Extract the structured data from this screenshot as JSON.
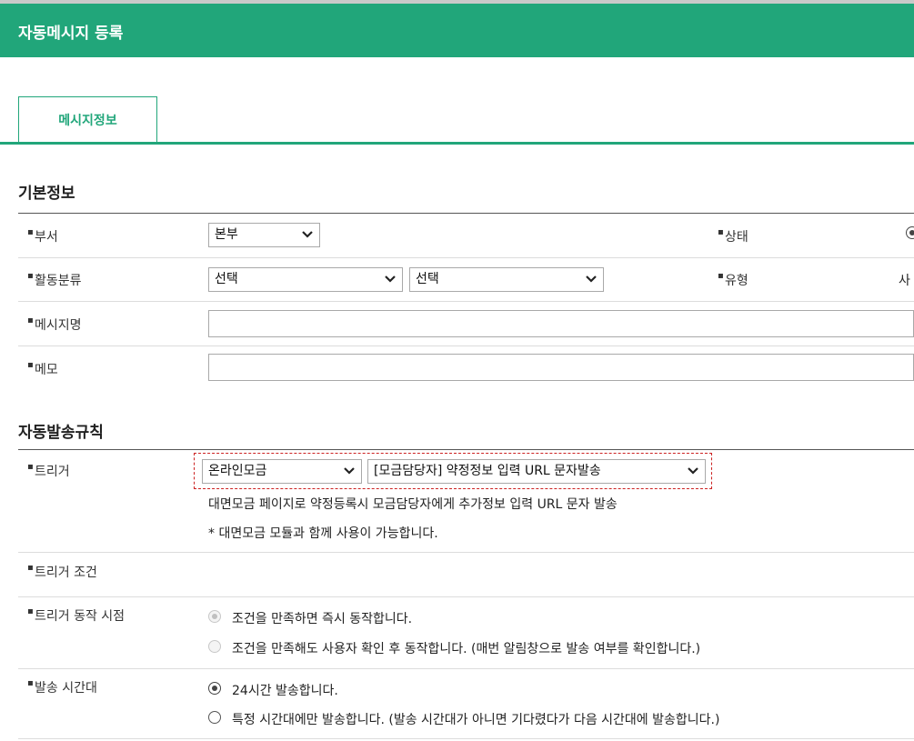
{
  "header": {
    "title": "자동메시지 등록"
  },
  "tabs": [
    {
      "label": "메시지정보"
    }
  ],
  "basic": {
    "title": "기본정보",
    "department": {
      "label": "부서",
      "value": "본부"
    },
    "status": {
      "label": "상태"
    },
    "activity": {
      "label": "활동분류",
      "value1": "선택",
      "value2": "선택"
    },
    "type": {
      "label": "유형",
      "value": "사"
    },
    "message_name": {
      "label": "메시지명",
      "value": ""
    },
    "memo": {
      "label": "메모",
      "value": ""
    }
  },
  "rules": {
    "title": "자동발송규칙",
    "trigger": {
      "label": "트리거",
      "category": "온라인모금",
      "event": "[모금담당자] 약정정보 입력 URL 문자발송",
      "description": "대면모금 페이지로 약정등록시 모금담당자에게 추가정보 입력 URL 문자 발송",
      "note": "* 대면모금 모듈과 함께 사용이 가능합니다."
    },
    "condition": {
      "label": "트리거 조건"
    },
    "timing": {
      "label": "트리거 동작 시점",
      "option1": "조건을 만족하면 즉시 동작합니다.",
      "option2": "조건을 만족해도 사용자 확인 후 동작합니다. (매번 알림창으로 발송 여부를 확인합니다.)"
    },
    "send_time": {
      "label": "발송 시간대",
      "option1": "24시간 발송합니다.",
      "option2": "특정 시간대에만 발송합니다. (발송 시간대가 아니면 기다렸다가 다음 시간대에 발송합니다.)"
    }
  },
  "icons": {
    "bullet": "bullet-dot",
    "dropdown": "chevron-down-icon",
    "radio": "radio-icon"
  },
  "colors": {
    "accent": "#21a67a",
    "highlight": "#cc2222"
  }
}
